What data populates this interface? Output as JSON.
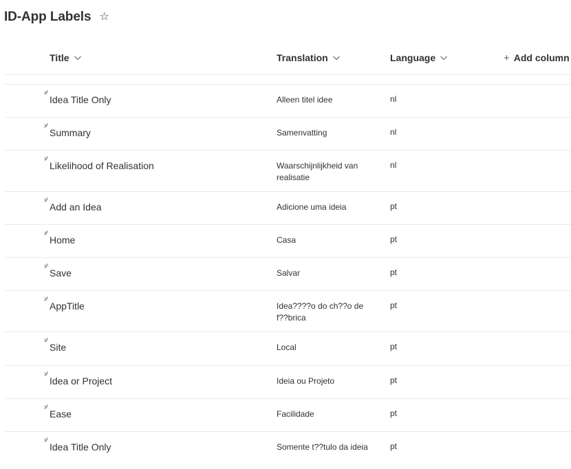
{
  "header": {
    "list_title": "ID-App Labels",
    "favorite_icon": "star-outline-icon"
  },
  "columns": {
    "title": "Title",
    "translation": "Translation",
    "language": "Language",
    "add_column": "Add column",
    "add_icon": "plus-icon",
    "sort_icon": "chevron-down-icon"
  },
  "row_icon": "new-item-sparkle-icon",
  "rows": [
    {
      "title": "Idea Title Only",
      "translation": "Alleen titel idee",
      "language": "nl"
    },
    {
      "title": "Summary",
      "translation": "Samenvatting",
      "language": "nl"
    },
    {
      "title": "Likelihood of Realisation",
      "translation": "Waarschijnlijkheid van realisatie",
      "language": "nl"
    },
    {
      "title": "Add an Idea",
      "translation": "Adicione uma ideia",
      "language": "pt"
    },
    {
      "title": "Home",
      "translation": "Casa",
      "language": "pt"
    },
    {
      "title": "Save",
      "translation": "Salvar",
      "language": "pt"
    },
    {
      "title": "AppTitle",
      "translation": "Idea????o do ch??o de f??brica",
      "language": "pt"
    },
    {
      "title": "Site",
      "translation": "Local",
      "language": "pt"
    },
    {
      "title": "Idea or Project",
      "translation": "Ideia ou Projeto",
      "language": "pt"
    },
    {
      "title": "Ease",
      "translation": "Facilidade",
      "language": "pt"
    },
    {
      "title": "Idea Title Only",
      "translation": "Somente t??tulo da ideia",
      "language": "pt"
    }
  ]
}
